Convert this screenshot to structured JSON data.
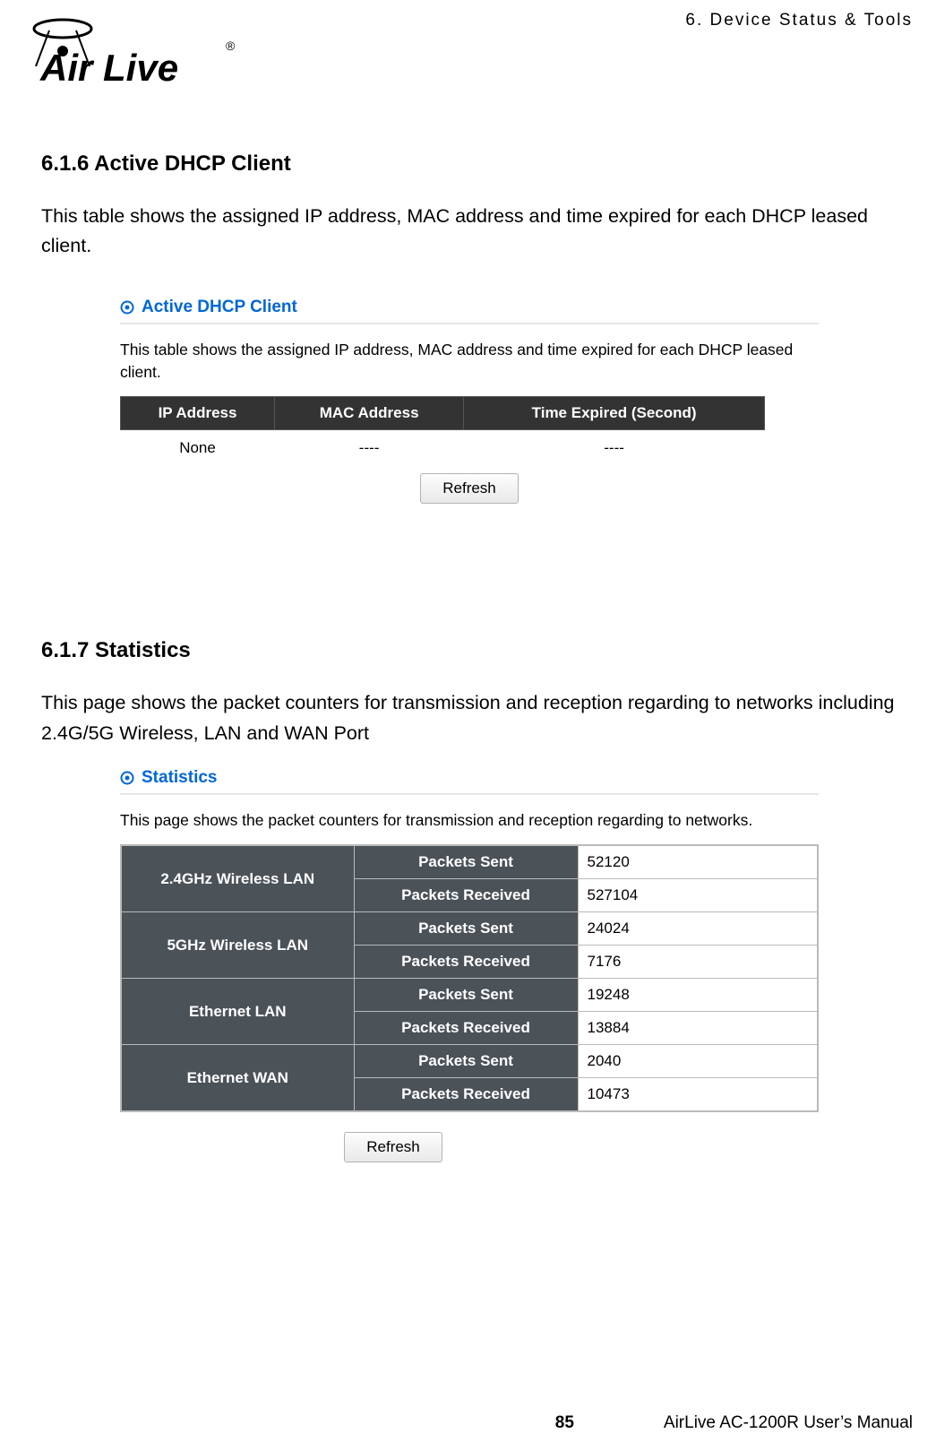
{
  "header": {
    "chapter": "6.  Device  Status  &  Tools",
    "logo_main": "Air Live",
    "logo_reg": "®"
  },
  "section1": {
    "heading": "6.1.6 Active DHCP Client",
    "text": "This table shows the assigned IP address, MAC address and time expired for each DHCP leased client."
  },
  "dhcp_panel": {
    "title": "Active DHCP Client",
    "desc": "This table shows the assigned IP address, MAC address and time expired for each DHCP leased client.",
    "cols": [
      "IP Address",
      "MAC Address",
      "Time Expired (Second)"
    ],
    "row": [
      "None",
      "----",
      "----"
    ],
    "refresh": "Refresh"
  },
  "section2": {
    "heading": "6.1.7 Statistics",
    "text": "This page shows the packet counters for transmission and reception regarding to networks including 2.4G/5G Wireless, LAN and WAN Port"
  },
  "stats_panel": {
    "title": "Statistics",
    "desc": "This page shows the packet counters for transmission and reception regarding to networks.",
    "labels": {
      "sent": "Packets Sent",
      "recv": "Packets Received"
    },
    "rows": [
      {
        "name": "2.4GHz Wireless LAN",
        "sent": "52120",
        "recv": "527104"
      },
      {
        "name": "5GHz Wireless LAN",
        "sent": "24024",
        "recv": "7176"
      },
      {
        "name": "Ethernet LAN",
        "sent": "19248",
        "recv": "13884"
      },
      {
        "name": "Ethernet WAN",
        "sent": "2040",
        "recv": "10473"
      }
    ],
    "refresh": "Refresh"
  },
  "footer": {
    "page_num": "85",
    "manual": "AirLive AC-1200R User’s Manual"
  }
}
